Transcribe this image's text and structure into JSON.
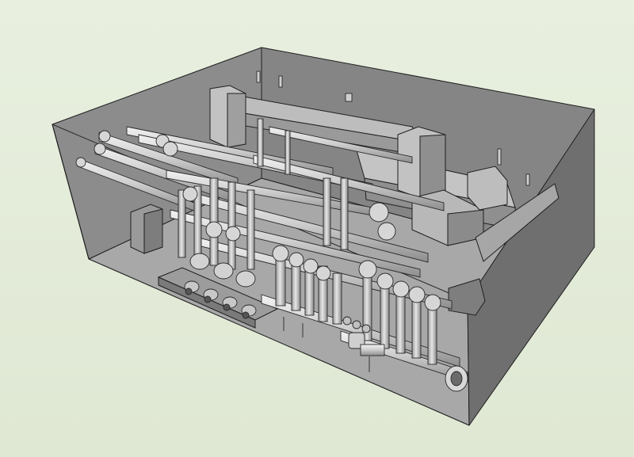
{
  "scene": {
    "subject": "",
    "background_color": "#e3ebd7",
    "colors": {
      "outline": "#1f1f1f",
      "wall_back": "#8c8c8c",
      "wall_left": "#7f7f7f",
      "wall_right": "#6f6f6f",
      "floor": "#a9a9a9",
      "pipe": "#cfcfcf",
      "pipe_shade": "#9a9a9a",
      "duct": "#bdbdbd",
      "duct_dark": "#8a8a8a"
    }
  }
}
